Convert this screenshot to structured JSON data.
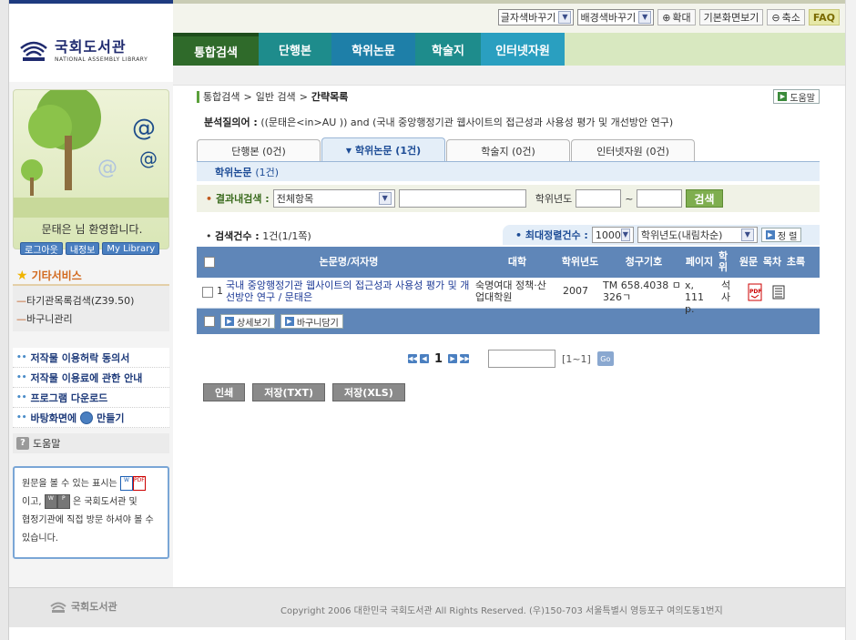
{
  "colors": {
    "navy": "#1f2a6e",
    "green_tab": "#3a7d2a",
    "teal_tab": "#1d8c8c",
    "blue_tab": "#2a6fb3",
    "header_blue": "#5f86b8",
    "accent_green": "#7fae4f"
  },
  "top_tools": {
    "font_color": "글자색바꾸기",
    "bg_color": "배경색바꾸기",
    "zoom_in": "확대",
    "default_view": "기본화면보기",
    "zoom_out": "축소",
    "faq": "FAQ"
  },
  "logo": {
    "main": "국회도서관",
    "sub": "NATIONAL ASSEMBLY LIBRARY"
  },
  "gnb": [
    "통합검색",
    "단행본",
    "학위논문",
    "학술지",
    "인터넷자원"
  ],
  "sidebar": {
    "welcome": "문태은 님 환영합니다.",
    "buttons": [
      "로그아웃",
      "내정보",
      "My Library"
    ],
    "services_title": "기타서비스",
    "services": [
      "타기관목록검색(Z39.50)",
      "바구니관리"
    ],
    "links": [
      "저작물 이용허락 동의서",
      "저작물 이용료에 관한 안내",
      "프로그램 다운로드",
      "바탕화면에",
      "만들기"
    ],
    "help": "도움말",
    "info": {
      "line1": "원문을 볼 수 있는 표시는",
      "line2a": "이고,",
      "line2b": "은 국회도서관 및",
      "line3": "협정기관에 직접 방문 하셔야 볼 수",
      "line4": "있습니다."
    }
  },
  "breadcrumb": {
    "home": "통합검색",
    "sep": ">",
    "mid": "일반 검색",
    "current": "간략목록"
  },
  "help_button": "도움말",
  "query": {
    "label": "분석질의어 :",
    "text": "((문태은<in>AU )) and (국내 중앙행정기관 웹사이트의 접근성과 사용성 평가 및 개선방안 연구)"
  },
  "result_tabs": [
    {
      "label": "단행본 (0건)",
      "active": false
    },
    {
      "label": "학위논문 (1건)",
      "active": true
    },
    {
      "label": "학술지 (0건)",
      "active": false
    },
    {
      "label": "인터넷자원 (0건)",
      "active": false
    }
  ],
  "subhead": {
    "title": "학위논문",
    "count": "(1건)"
  },
  "filter": {
    "label": "결과내검색 :",
    "select": "전체항목",
    "year_label": "학위년도",
    "range_sep": "~",
    "search_btn": "검색"
  },
  "count": {
    "label": "검색건수 :",
    "value": "1건(1/1쪽)"
  },
  "sort": {
    "label": "최대정렬건수 :",
    "max": "1000",
    "order": "학위년도(내림차순)",
    "btn": "정 렬"
  },
  "table": {
    "headers": {
      "title": "논문명/저자명",
      "school": "대학",
      "year": "학위년도",
      "callno": "청구기호",
      "pages": "페이지",
      "degree": "학위",
      "fulltext": "원문",
      "toc": "목차",
      "abstract": "초록"
    },
    "rows": [
      {
        "no": "1",
        "title": "국내 중앙행정기관 웹사이트의 접근성과 사용성 평가 및 개선방안 연구 / 문태은",
        "school": "숙명여대 정책·산업대학원",
        "year": "2007",
        "callno": "TM 658.4038 ㅁ326ㄱ",
        "pages": "ⅹ, 111 p.",
        "degree": "석사"
      }
    ],
    "footer_buttons": [
      "상세보기",
      "바구니담기"
    ]
  },
  "pager": {
    "current": "1",
    "range": "[1~1]",
    "go": "Go"
  },
  "actions": [
    "인쇄",
    "저장(TXT)",
    "저장(XLS)"
  ],
  "footer": {
    "logo": "국회도서관",
    "copyright": "Copyright 2006 대한민국 국회도서관 All Rights Reserved. (우)150-703 서울특별시 영등포구 여의도동1번지"
  }
}
